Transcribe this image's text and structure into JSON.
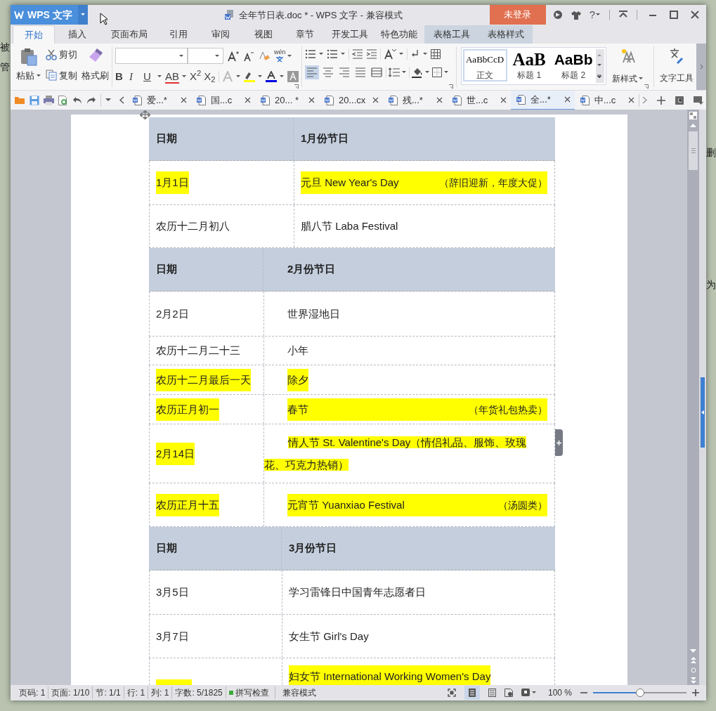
{
  "desktop": {
    "left_texts": [
      "被",
      "管"
    ],
    "right_texts": [
      "删",
      "为"
    ]
  },
  "window": {
    "app_button": "WPS 文字",
    "title": "全年节日表.doc * - WPS 文字 - 兼容模式",
    "login": "未登录",
    "help": "?"
  },
  "menu_tabs": [
    {
      "label": "开始",
      "selected": true,
      "contextual": false
    },
    {
      "label": "插入",
      "selected": false,
      "contextual": false
    },
    {
      "label": "页面布局",
      "selected": false,
      "contextual": false
    },
    {
      "label": "引用",
      "selected": false,
      "contextual": false
    },
    {
      "label": "审阅",
      "selected": false,
      "contextual": false
    },
    {
      "label": "视图",
      "selected": false,
      "contextual": false
    },
    {
      "label": "章节",
      "selected": false,
      "contextual": false
    },
    {
      "label": "开发工具",
      "selected": false,
      "contextual": false
    },
    {
      "label": "特色功能",
      "selected": false,
      "contextual": false
    },
    {
      "label": "表格工具",
      "selected": false,
      "contextual": true
    },
    {
      "label": "表格样式",
      "selected": false,
      "contextual": true
    }
  ],
  "ribbon": {
    "paste": "粘贴",
    "cut": "剪切",
    "copy": "复制",
    "format_painter": "格式刷",
    "pinyin": "wén",
    "font_glyphs": [
      "B",
      "I",
      "U",
      "AB",
      "X$^{2}$",
      "X$_{2}$"
    ],
    "align": [
      {
        "selected": true
      },
      {
        "selected": false
      },
      {
        "selected": false
      },
      {
        "selected": false
      },
      {
        "selected": false
      }
    ],
    "styles": [
      {
        "preview": "AaBbCcD",
        "label": "正文",
        "selected": true
      },
      {
        "preview": "AaB",
        "label": "标题 1",
        "selected": false
      },
      {
        "preview": "AaBb",
        "label": "标题 2",
        "selected": false
      }
    ],
    "new_style": "新样式",
    "text_tools": "文字工具"
  },
  "doc_tabs": [
    {
      "label": "爱...*",
      "selected": false
    },
    {
      "label": "国...c",
      "selected": false
    },
    {
      "label": "20... *",
      "selected": false
    },
    {
      "label": "20...cx",
      "selected": false
    },
    {
      "label": "残...*",
      "selected": false
    },
    {
      "label": "世...c",
      "selected": false
    },
    {
      "label": "全...*",
      "selected": true
    },
    {
      "label": "中...c",
      "selected": false
    }
  ],
  "months": [
    {
      "date_heading": "日期",
      "title": "1月份节日",
      "rows": [
        {
          "date": "1月1日",
          "date_highlight": true,
          "event": "元旦 New Year's Day",
          "note": "（辞旧迎新，年度大促）",
          "event_highlight": true
        },
        {
          "date": "农历十二月初八",
          "date_highlight": false,
          "event": "腊八节 Laba Festival",
          "event_highlight": false
        }
      ]
    },
    {
      "date_heading": "日期",
      "title": "2月份节日",
      "rows": [
        {
          "date": "2月2日",
          "date_highlight": false,
          "event": "世界湿地日",
          "event_highlight": false
        },
        {
          "date": "农历十二月二十三",
          "date_highlight": false,
          "event": "小年",
          "event_highlight": false
        },
        {
          "date": "农历十二月最后一天",
          "date_highlight": true,
          "event": "除夕",
          "event_highlight": true
        },
        {
          "date": "农历正月初一",
          "date_highlight": true,
          "event": "春节",
          "note": "（年货礼包热卖）",
          "event_highlight": true
        },
        {
          "date": "2月14日",
          "date_highlight": true,
          "event": "情人节 St. Valentine's Day（情侣礼品、服饰、玫瑰花、巧克力热销）",
          "event_highlight": true
        },
        {
          "date": "农历正月十五",
          "date_highlight": true,
          "event": "元宵节 Yuanxiao Festival",
          "note": "（汤圆类）",
          "event_highlight": true
        }
      ]
    },
    {
      "date_heading": "日期",
      "title": "3月份节日",
      "rows": [
        {
          "date": "3月5日",
          "date_highlight": false,
          "event": "学习雷锋日中国青年志愿者日",
          "event_highlight": false
        },
        {
          "date": "3月7日",
          "date_highlight": false,
          "event": "女生节 Girl's Day",
          "event_highlight": false
        },
        {
          "date_highlight": true,
          "event": "妇女节 International Working Women's Day",
          "event_highlight": true
        }
      ]
    }
  ],
  "status_bar": {
    "items": [
      "页码: 1",
      "页面: 1/10",
      "节: 1/1",
      "行: 1",
      "列: 1",
      "字数: 5/1825"
    ],
    "spell_check": "拼写检查",
    "mode": "兼容模式",
    "zoom": "100 %",
    "zoom_slider": {
      "level": 0.5
    }
  }
}
